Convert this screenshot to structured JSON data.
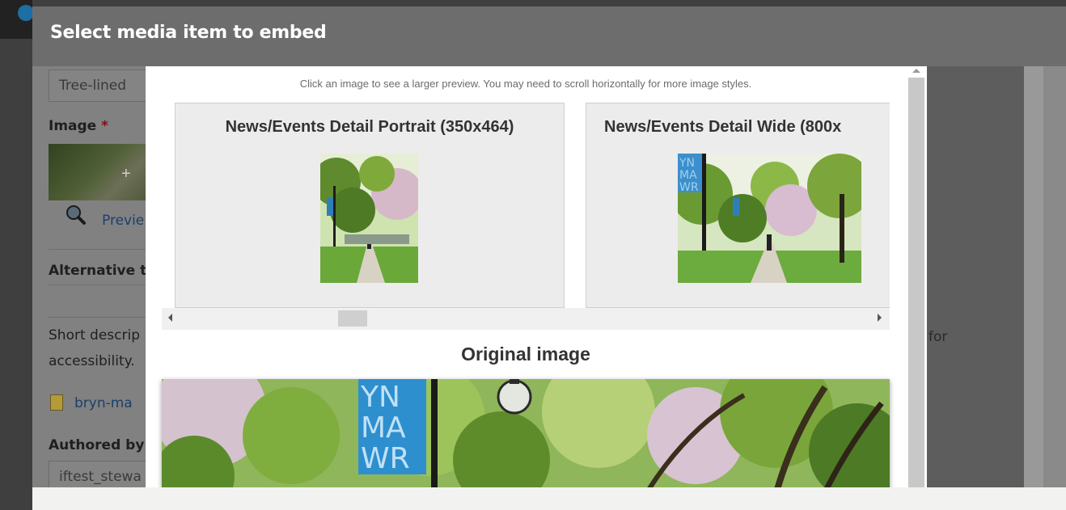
{
  "dialog": {
    "title": "Select media item to embed",
    "instructions": "Click an image to see a larger preview. You may need to scroll horizontally for more image styles.",
    "styles": [
      {
        "label": "News/Events Detail Portrait (350x464)"
      },
      {
        "label": "News/Events Detail Wide (800x"
      }
    ],
    "original_label": "Original image",
    "banner_text": [
      "YN",
      "MA",
      "WR"
    ]
  },
  "background_form": {
    "name_value": "Tree-lined",
    "image_label": "Image",
    "required_mark": "*",
    "preview_link": "Previe",
    "alt_label": "Alternative t",
    "desc_line1": "Short descrip",
    "desc_line2": "accessibility.",
    "desc_suffix": "for",
    "file_link": "bryn-ma",
    "authored_label": "Authored by",
    "author_value": "iftest_stewa"
  },
  "colors": {
    "overlay": "#6d6d6d",
    "panel": "#ffffff",
    "card": "#ececec",
    "banner": "#2e8fcf"
  }
}
